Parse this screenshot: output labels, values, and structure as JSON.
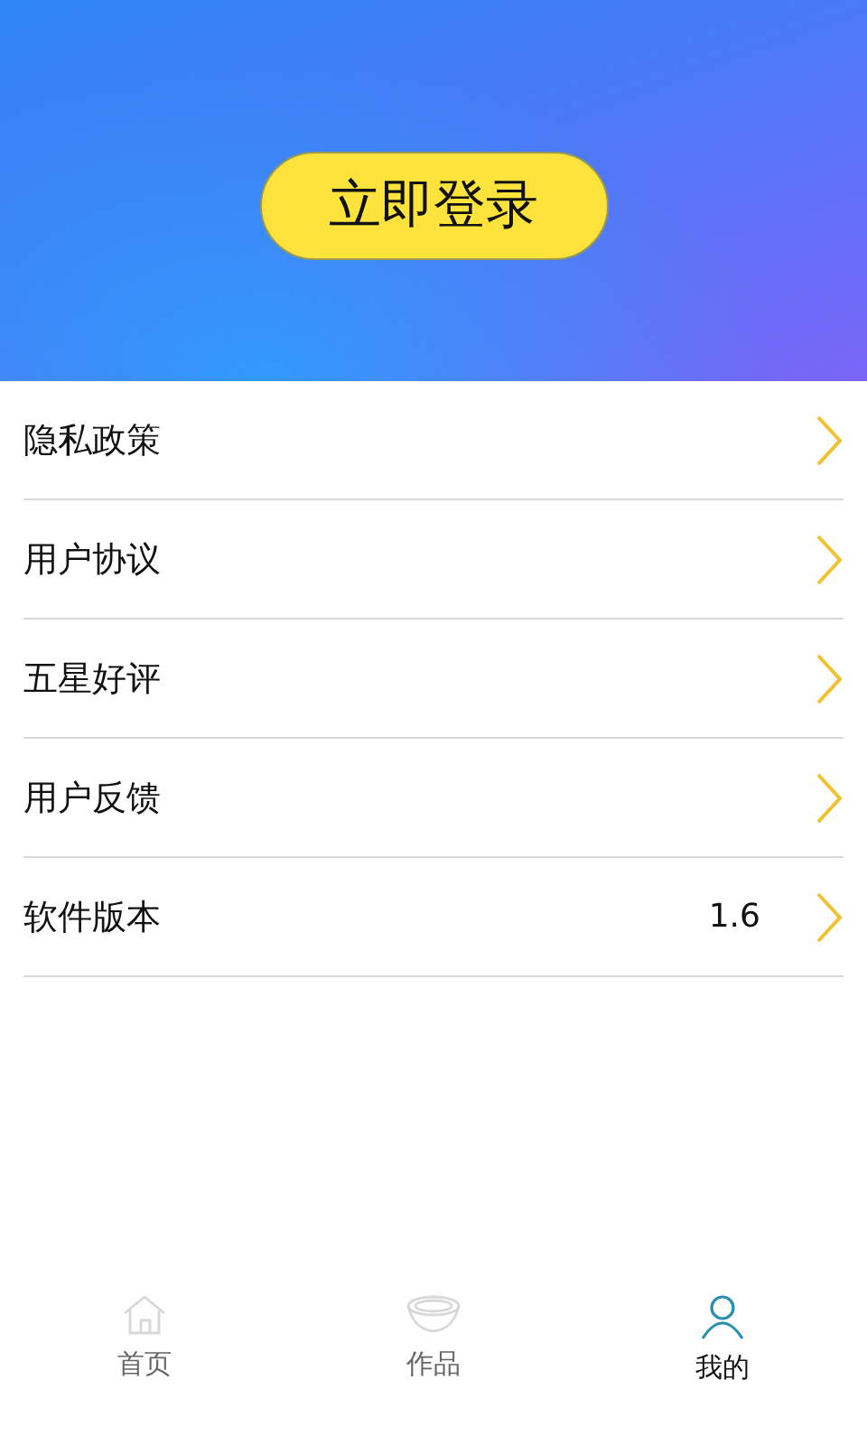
{
  "header": {
    "login_button": "立即登录"
  },
  "menu": [
    {
      "label": "隐私政策"
    },
    {
      "label": "用户协议"
    },
    {
      "label": "五星好评"
    },
    {
      "label": "用户反馈"
    },
    {
      "label": "软件版本",
      "value": "1.6"
    }
  ],
  "tabs": [
    {
      "label": "首页",
      "kind": "home",
      "selected": false
    },
    {
      "label": "作品",
      "kind": "bowl",
      "selected": false
    },
    {
      "label": "我的",
      "kind": "user",
      "selected": true
    }
  ]
}
